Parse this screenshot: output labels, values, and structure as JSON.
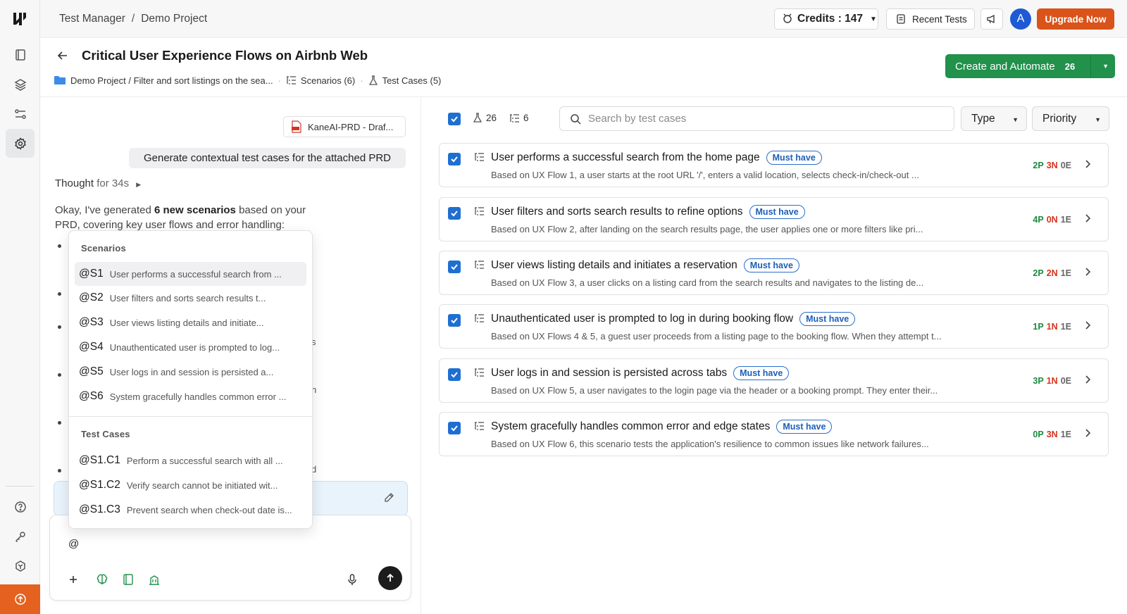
{
  "header": {
    "breadcrumb": [
      "Test Manager",
      "Demo Project"
    ],
    "breadcrumb_sep": "/",
    "credits_label": "Credits : 147",
    "recent_tests_label": "Recent Tests",
    "avatar_initial": "A",
    "upgrade_label": "Upgrade Now"
  },
  "page": {
    "title": "Critical User Experience Flows on Airbnb Web",
    "path": "Demo Project / Filter and sort listings on the sea...",
    "scenarios_tab": "Scenarios (6)",
    "testcases_tab": "Test Cases (5)",
    "create_label": "Create and Automate",
    "create_count": "26"
  },
  "chat": {
    "attachment_name": "KaneAI-PRD - Draf...",
    "user_prompt": "Generate contextual test cases for the attached PRD",
    "thought_label": "Thought",
    "thought_duration": "for 34s",
    "reply_prefix": "Okay, I've generated ",
    "reply_bold": "6 new scenarios",
    "reply_suffix": " based on your PRD, covering key user flows and error handling:",
    "ghost_text": [
      "s",
      "n",
      "d"
    ],
    "composer_value": "@"
  },
  "mention_menu": {
    "scenarios_heading": "Scenarios",
    "scenarios": [
      {
        "code": "@S1",
        "text": "User performs a successful search from ..."
      },
      {
        "code": "@S2",
        "text": "User filters and sorts search results t..."
      },
      {
        "code": "@S3",
        "text": "User views listing details and initiate..."
      },
      {
        "code": "@S4",
        "text": "Unauthenticated user is prompted to log..."
      },
      {
        "code": "@S5",
        "text": "User logs in and session is persisted a..."
      },
      {
        "code": "@S6",
        "text": "System gracefully handles common error ..."
      }
    ],
    "testcases_heading": "Test Cases",
    "testcases": [
      {
        "code": "@S1.C1",
        "text": "Perform a successful search with all ..."
      },
      {
        "code": "@S1.C2",
        "text": "Verify search cannot be initiated wit..."
      },
      {
        "code": "@S1.C3",
        "text": "Prevent search when check-out date is..."
      }
    ]
  },
  "toolbar": {
    "testcase_count": "26",
    "scenario_count": "6",
    "search_placeholder": "Search by test cases",
    "type_label": "Type",
    "priority_label": "Priority"
  },
  "scenarios": [
    {
      "title": "User performs a successful search from the home page",
      "badge": "Must have",
      "desc": "Based on UX Flow 1, a user starts at the root URL '/', enters a valid location, selects check-in/check-out ...",
      "p": "2P",
      "n": "3N",
      "e": "0E"
    },
    {
      "title": "User filters and sorts search results to refine options",
      "badge": "Must have",
      "desc": "Based on UX Flow 2, after landing on the search results page, the user applies one or more filters like pri...",
      "p": "4P",
      "n": "0N",
      "e": "1E"
    },
    {
      "title": "User views listing details and initiates a reservation",
      "badge": "Must have",
      "desc": "Based on UX Flow 3, a user clicks on a listing card from the search results and navigates to the listing de...",
      "p": "2P",
      "n": "2N",
      "e": "1E"
    },
    {
      "title": "Unauthenticated user is prompted to log in during booking flow",
      "badge": "Must have",
      "desc": "Based on UX Flows 4 & 5, a guest user proceeds from a listing page to the booking flow. When they attempt t...",
      "p": "1P",
      "n": "1N",
      "e": "1E"
    },
    {
      "title": "User logs in and session is persisted across tabs",
      "badge": "Must have",
      "desc": "Based on UX Flow 5, a user navigates to the login page via the header or a booking prompt. They enter their...",
      "p": "3P",
      "n": "1N",
      "e": "0E"
    },
    {
      "title": "System gracefully handles common error and edge states",
      "badge": "Must have",
      "desc": "Based on UX Flow 6, this scenario tests the application's resilience to common issues like network failures...",
      "p": "0P",
      "n": "3N",
      "e": "1E"
    }
  ],
  "colors": {
    "accent_blue": "#1f6fd1",
    "create_green": "#21914b",
    "upgrade_orange": "#d9531a",
    "pass_green": "#1e8a3f",
    "neg_red": "#d8331f"
  }
}
